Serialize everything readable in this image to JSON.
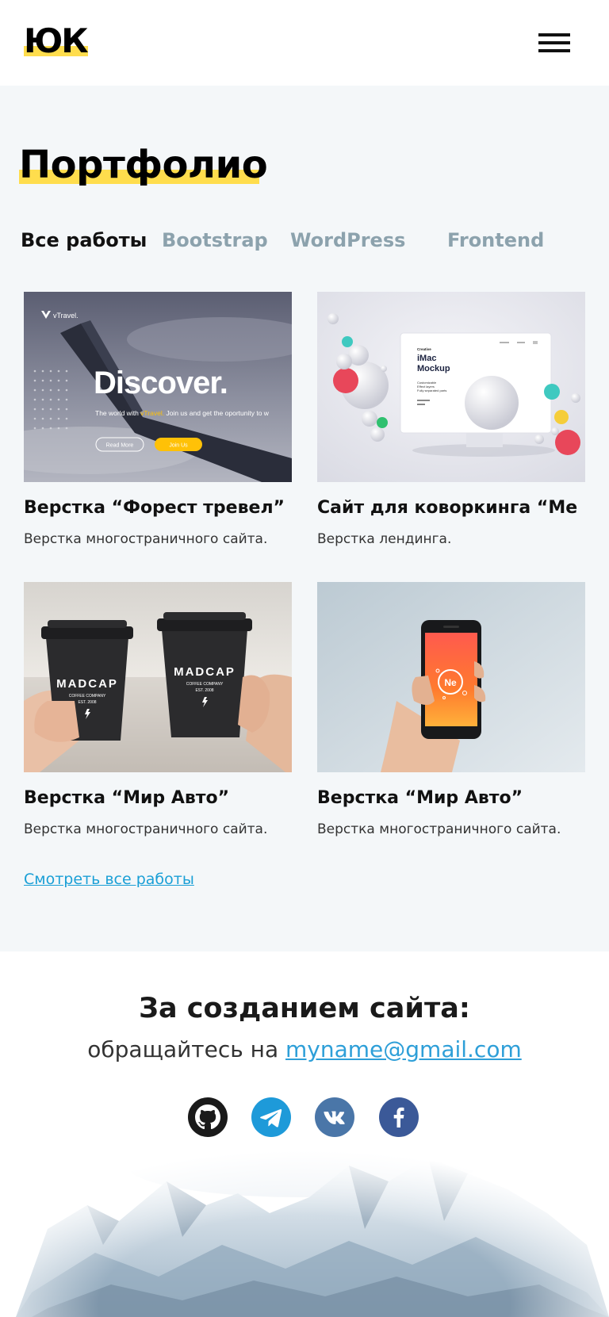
{
  "header": {
    "logo": "ЮК",
    "menu_icon": "hamburger-menu-icon"
  },
  "portfolio": {
    "title": "Портфолио",
    "tabs": [
      {
        "label": "Все работы",
        "active": true
      },
      {
        "label": "Bootstrap",
        "active": false
      },
      {
        "label": "WordPress",
        "active": false
      },
      {
        "label": "Frontend",
        "active": false
      }
    ],
    "cards": [
      {
        "title": "Верстка “Форест тревел”",
        "description": "Верстка многостраничного сайта.",
        "image": {
          "brand": "vTravel.",
          "headline": "Discover.",
          "tagline_pre": "The world with ",
          "tagline_brand": "vTravel.",
          "tagline_post": " Join us and get the oportunity to w",
          "button_primary": "Read More",
          "button_secondary": "Join Us"
        }
      },
      {
        "title": "Сайт для коворкинга “Ме",
        "description": "Верстка лендинга.",
        "image": {
          "label": "Creative",
          "heading_line1": "iMac",
          "heading_line2": "Mockup",
          "features": [
            "Customizable",
            "Effect layers",
            "Fully separated parts"
          ]
        }
      },
      {
        "title": "Верстка “Мир Авто”",
        "description": "Верстка многостраничного сайта.",
        "image": {
          "brand": "MADCAP",
          "sub": "COFFEE COMPANY",
          "est": "EST. 2008"
        }
      },
      {
        "title": "Верстка “Мир Авто”",
        "description": "Верстка многостраничного сайта.",
        "image": {
          "screen_logo": "Ne"
        }
      }
    ],
    "view_all": "Смотреть все работы"
  },
  "footer": {
    "title": "За созданием сайта:",
    "contact_prefix": "обращайтесь на ",
    "email": "myname@gmail.com",
    "socials": [
      {
        "name": "github",
        "icon": "github-icon",
        "color": "#1a1a1a"
      },
      {
        "name": "telegram",
        "icon": "telegram-icon",
        "color": "#1e9ad9"
      },
      {
        "name": "vk",
        "icon": "vk-icon",
        "color": "#4a76a8"
      },
      {
        "name": "facebook",
        "icon": "facebook-icon",
        "color": "#3b5998"
      }
    ]
  },
  "colors": {
    "accent_yellow": "#ffdd4d",
    "link_blue": "#1a9fd6",
    "tab_inactive": "#8ca2ad",
    "section_bg": "#f4f7f9"
  }
}
